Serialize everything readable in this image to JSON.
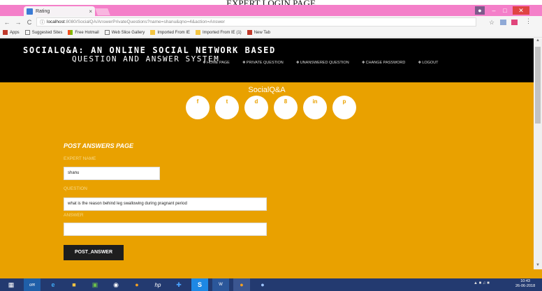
{
  "caption": "EXPERT LOGIN PAGE",
  "browser": {
    "tab_title": "Rating",
    "tab_close": "×",
    "url_host": "localhost",
    "url_path": ":8080/SocialQA/AnswerPrivateQuestions?name=shanu&qno=4&action=Answer",
    "back": "←",
    "forward": "→",
    "reload": "C",
    "star": "☆",
    "menu": "⋮",
    "bookmarks": [
      "Apps",
      "Suggested Sites",
      "Free Hotmail",
      "Web Slice Gallery",
      "Imported From IE",
      "Imported From IE (1)",
      "New Tab"
    ]
  },
  "header": {
    "logo_line1": "SOCIALQ&A: AN ONLINE SOCIAL NETWORK BASED",
    "logo_line2": "QUESTION AND ANSWER SYSTEM",
    "nav": [
      {
        "label": "HOME PAGE"
      },
      {
        "label": "PRIVATE QUESTION"
      },
      {
        "label": "UNANSWERED QUESTION"
      },
      {
        "label": "CHANGE PASSWORD"
      },
      {
        "label": "LOGOUT"
      }
    ]
  },
  "main": {
    "brand": "SocialQ&A",
    "socials": [
      "f",
      "t",
      "d",
      "8",
      "in",
      "p"
    ],
    "form_title": "POST ANSWERS PAGE",
    "expert_name_label": "EXPERT NAME",
    "expert_name_value": "shanu",
    "question_label": "QUESTION",
    "question_value": "what is the reason behind leg swallowing during pragnant period",
    "answer_label": "ANSWER",
    "answer_value": "",
    "post_button": "POST_ANSWER"
  },
  "taskbar": {
    "clock_time": "10:43",
    "clock_date": "26-06-2018"
  },
  "colors": {
    "accent": "#e9a100",
    "header_bg": "#000000",
    "titlebar": "#f47fc9",
    "button": "#1e1e1e"
  }
}
